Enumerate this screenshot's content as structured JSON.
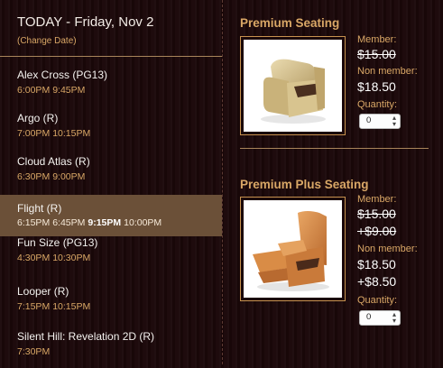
{
  "header": {
    "title": "TODAY - Friday, Nov 2",
    "change_date": "(Change Date)"
  },
  "movies": [
    {
      "title": "Alex Cross (PG13)",
      "times": [
        "6:00PM",
        "9:45PM"
      ]
    },
    {
      "title": "Argo (R)",
      "times": [
        "7:00PM",
        "10:15PM"
      ]
    },
    {
      "title": "Cloud Atlas (R)",
      "times": [
        "6:30PM",
        "9:00PM"
      ]
    },
    {
      "title": "Flight (R)",
      "times": [
        "6:15PM",
        "6:45PM",
        "9:15PM",
        "10:00PM"
      ],
      "selected_time": "9:15PM"
    },
    {
      "title": "Fun Size (PG13)",
      "times": [
        "4:30PM",
        "10:30PM"
      ]
    },
    {
      "title": "Looper (R)",
      "times": [
        "7:15PM",
        "10:15PM"
      ]
    },
    {
      "title": "Silent Hill: Revelation 2D (R)",
      "times": [
        "7:30PM"
      ]
    }
  ],
  "selected_movie": "Flight (R)",
  "seating": [
    {
      "title": "Premium Seating",
      "member_label": "Member:",
      "member_price": "$15.00",
      "member_price_struck": true,
      "nonmember_label": "Non member:",
      "nonmember_price": "$18.50",
      "quantity_label": "Quantity:",
      "quantity_value": "0"
    },
    {
      "title": "Premium Plus Seating",
      "member_label": "Member:",
      "member_price": "$15.00",
      "member_price_struck": true,
      "member_extra": "+$9.00",
      "member_extra_struck": true,
      "nonmember_label": "Non member:",
      "nonmember_price": "$18.50",
      "nonmember_extra": "+$8.50",
      "quantity_label": "Quantity:",
      "quantity_value": "0"
    }
  ],
  "colors": {
    "accent": "#d9a766",
    "selected_row": "#6b5038",
    "background": "#1a0709"
  }
}
